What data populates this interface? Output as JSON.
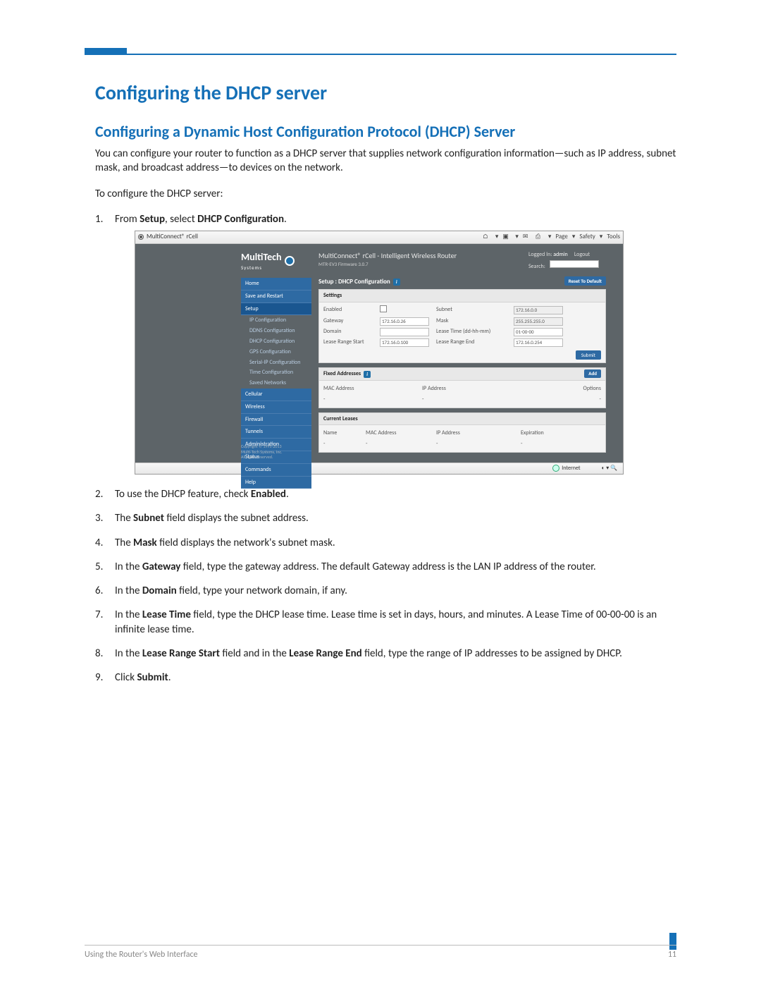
{
  "doc": {
    "h1": "Configuring the DHCP server",
    "h2": "Configuring a Dynamic Host Configuration Protocol (DHCP) Server",
    "intro": "You can configure your router to function as a DHCP server that supplies network configuration information—such as IP address, subnet mask, and broadcast address—to devices on the network.",
    "lead": "To configure the DHCP server:",
    "steps": {
      "s1a": "From ",
      "s1b": "Setup",
      "s1c": ", select ",
      "s1d": "DHCP Configuration",
      "s1e": ".",
      "s2a": "To use the DHCP feature, check ",
      "s2b": "Enabled",
      "s2c": ".",
      "s3a": "The ",
      "s3b": "Subnet",
      "s3c": " field displays the subnet address.",
      "s4a": "The ",
      "s4b": "Mask",
      "s4c": " field displays the network's subnet mask.",
      "s5a": "In the ",
      "s5b": "Gateway",
      "s5c": " field, type the gateway address. The default Gateway address is the LAN IP address of the router.",
      "s6a": "In the ",
      "s6b": "Domain",
      "s6c": " field, type your network domain, if any.",
      "s7a": "In the ",
      "s7b": "Lease Time",
      "s7c": " field, type the DHCP lease time. Lease time is set in days, hours, and minutes. A Lease Time of 00-00-00 is an infinite lease time.",
      "s8a": "In the ",
      "s8b": "Lease Range Start",
      "s8c": " field and in the ",
      "s8d": "Lease Range End",
      "s8e": " field, type the range of IP addresses to be assigned by DHCP.",
      "s9a": "Click ",
      "s9b": "Submit",
      "s9c": "."
    },
    "footer_left": "Using the Router's Web Interface",
    "footer_right": "11"
  },
  "shot": {
    "browser": {
      "tab": "MultiConnect® rCell",
      "menu": [
        "Page",
        "Safety",
        "Tools"
      ]
    },
    "statusbar": "Internet",
    "app": {
      "logo": {
        "brand": "MultiTech",
        "sub": "Systems"
      },
      "title": "MultiConnect® rCell - Intelligent Wireless Router",
      "subtitle": "MTR-EV3   Firmware 3.0.7",
      "user": {
        "loggedPrefix": "Logged In:",
        "loggedUser": "admin",
        "logout": "Logout",
        "searchLabel": "Search:"
      },
      "nav": {
        "Home": [],
        "Save and Restart": [],
        "Setup": [
          "IP Configuration",
          "DDNS Configuration",
          "DHCP Configuration",
          "GPS Configuration",
          "Serial-IP Configuration",
          "Time Configuration",
          "Saved Networks"
        ],
        "Cellular": [],
        "Wireless": [],
        "Firewall": [],
        "Tunnels": [],
        "Administration": [],
        "Status": [],
        "Commands": [],
        "Help": []
      },
      "crumb": "Setup : DHCP Configuration",
      "reset": "Reset To Default",
      "settings": {
        "title": "Settings",
        "labels": {
          "enabled": "Enabled",
          "gateway": "Gateway",
          "domain": "Domain",
          "lrs": "Lease Range Start",
          "subnet": "Subnet",
          "mask": "Mask",
          "lease": "Lease Time (dd-hh-mm)",
          "lre": "Lease Range End"
        },
        "values": {
          "gateway": "172.16.0.26",
          "lrs": "172.16.0.100",
          "subnet": "172.16.0.0",
          "mask": "255.255.255.0",
          "lease": "01-00-00",
          "lre": "172.16.0.254"
        },
        "submit": "Submit"
      },
      "fixed": {
        "title": "Fixed Addresses",
        "cols": [
          "MAC Address",
          "IP Address",
          "Options"
        ],
        "add": "Add",
        "empty": "-"
      },
      "leases": {
        "title": "Current Leases",
        "cols": [
          "Name",
          "MAC Address",
          "IP Address",
          "Expiration"
        ],
        "empty": "-"
      },
      "copyright1": "Copyright © 1995-2013",
      "copyright2": "Multi-Tech Systems, Inc.",
      "copyright3": "All rights reserved."
    }
  }
}
